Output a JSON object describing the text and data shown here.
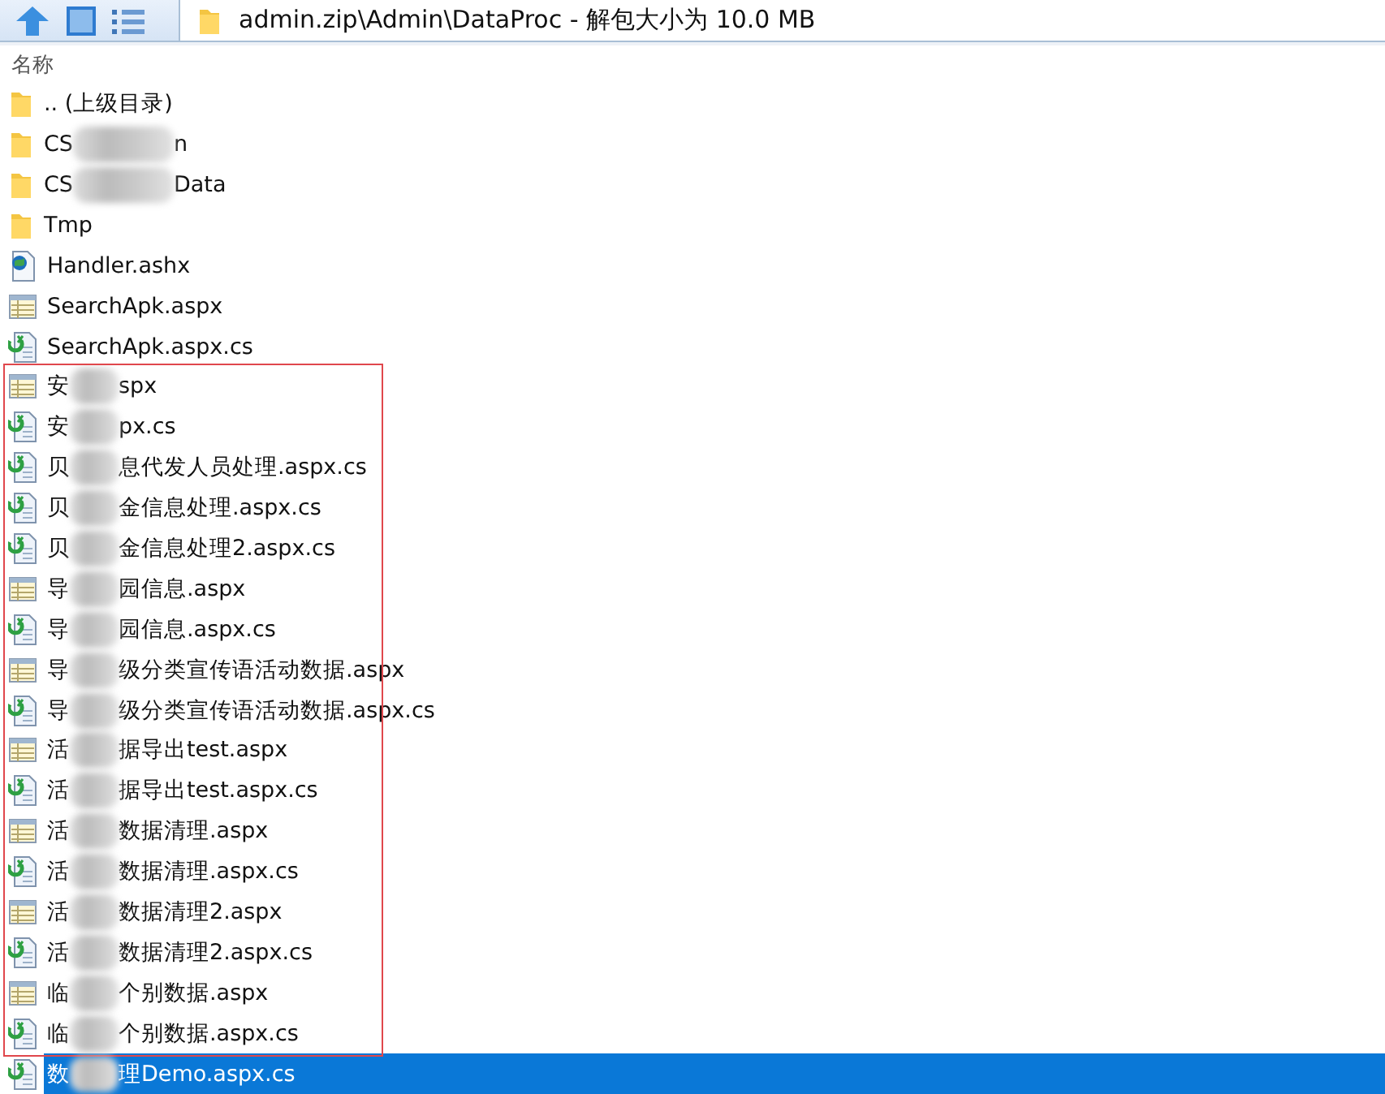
{
  "toolbar": {
    "path": "admin.zip\\Admin\\DataProc - 解包大小为 10.0 MB"
  },
  "list": {
    "column": "名称",
    "rows": [
      {
        "kind": "folder",
        "parts": [
          ".. (上级目录)"
        ],
        "selected": false
      },
      {
        "kind": "folder",
        "parts": [
          "CS",
          "n"
        ],
        "selected": false
      },
      {
        "kind": "folder",
        "parts": [
          "CS",
          "Data"
        ],
        "selected": false
      },
      {
        "kind": "folder",
        "parts": [
          "Tmp"
        ],
        "selected": false
      },
      {
        "kind": "handler",
        "parts": [
          "Handler.ashx"
        ],
        "selected": false
      },
      {
        "kind": "page",
        "parts": [
          "SearchApk.aspx"
        ],
        "selected": false
      },
      {
        "kind": "code",
        "parts": [
          "SearchApk.aspx.cs"
        ],
        "selected": false
      }
    ],
    "framed_rows": [
      {
        "kind": "page",
        "parts": [
          "安",
          "spx"
        ],
        "selected": false
      },
      {
        "kind": "code",
        "parts": [
          "安",
          "px.cs"
        ],
        "selected": false
      },
      {
        "kind": "code",
        "parts": [
          "贝",
          "息代发人员处理.aspx.cs"
        ],
        "selected": false
      },
      {
        "kind": "code",
        "parts": [
          "贝",
          "金信息处理.aspx.cs"
        ],
        "selected": false
      },
      {
        "kind": "code",
        "parts": [
          "贝",
          "金信息处理2.aspx.cs"
        ],
        "selected": false
      },
      {
        "kind": "page",
        "parts": [
          "导",
          "园信息.aspx"
        ],
        "selected": false
      },
      {
        "kind": "code",
        "parts": [
          "导",
          "园信息.aspx.cs"
        ],
        "selected": false
      },
      {
        "kind": "page",
        "parts": [
          "导",
          "级分类宣传语活动数据.aspx"
        ],
        "selected": false
      },
      {
        "kind": "code",
        "parts": [
          "导",
          "级分类宣传语活动数据.aspx.cs"
        ],
        "selected": false
      },
      {
        "kind": "page",
        "parts": [
          "活",
          "据导出test.aspx"
        ],
        "selected": false
      },
      {
        "kind": "code",
        "parts": [
          "活",
          "据导出test.aspx.cs"
        ],
        "selected": false
      },
      {
        "kind": "page",
        "parts": [
          "活",
          "数据清理.aspx"
        ],
        "selected": false
      },
      {
        "kind": "code",
        "parts": [
          "活",
          "数据清理.aspx.cs"
        ],
        "selected": false
      },
      {
        "kind": "page",
        "parts": [
          "活",
          "数据清理2.aspx"
        ],
        "selected": false
      },
      {
        "kind": "code",
        "parts": [
          "活",
          "数据清理2.aspx.cs"
        ],
        "selected": false
      },
      {
        "kind": "page",
        "parts": [
          "临",
          "个别数据.aspx"
        ],
        "selected": false
      },
      {
        "kind": "code",
        "parts": [
          "临",
          "个别数据.aspx.cs"
        ],
        "selected": false
      }
    ],
    "rows_after": [
      {
        "kind": "code",
        "parts": [
          "数",
          "理Demo.aspx.cs"
        ],
        "selected": true
      }
    ]
  }
}
